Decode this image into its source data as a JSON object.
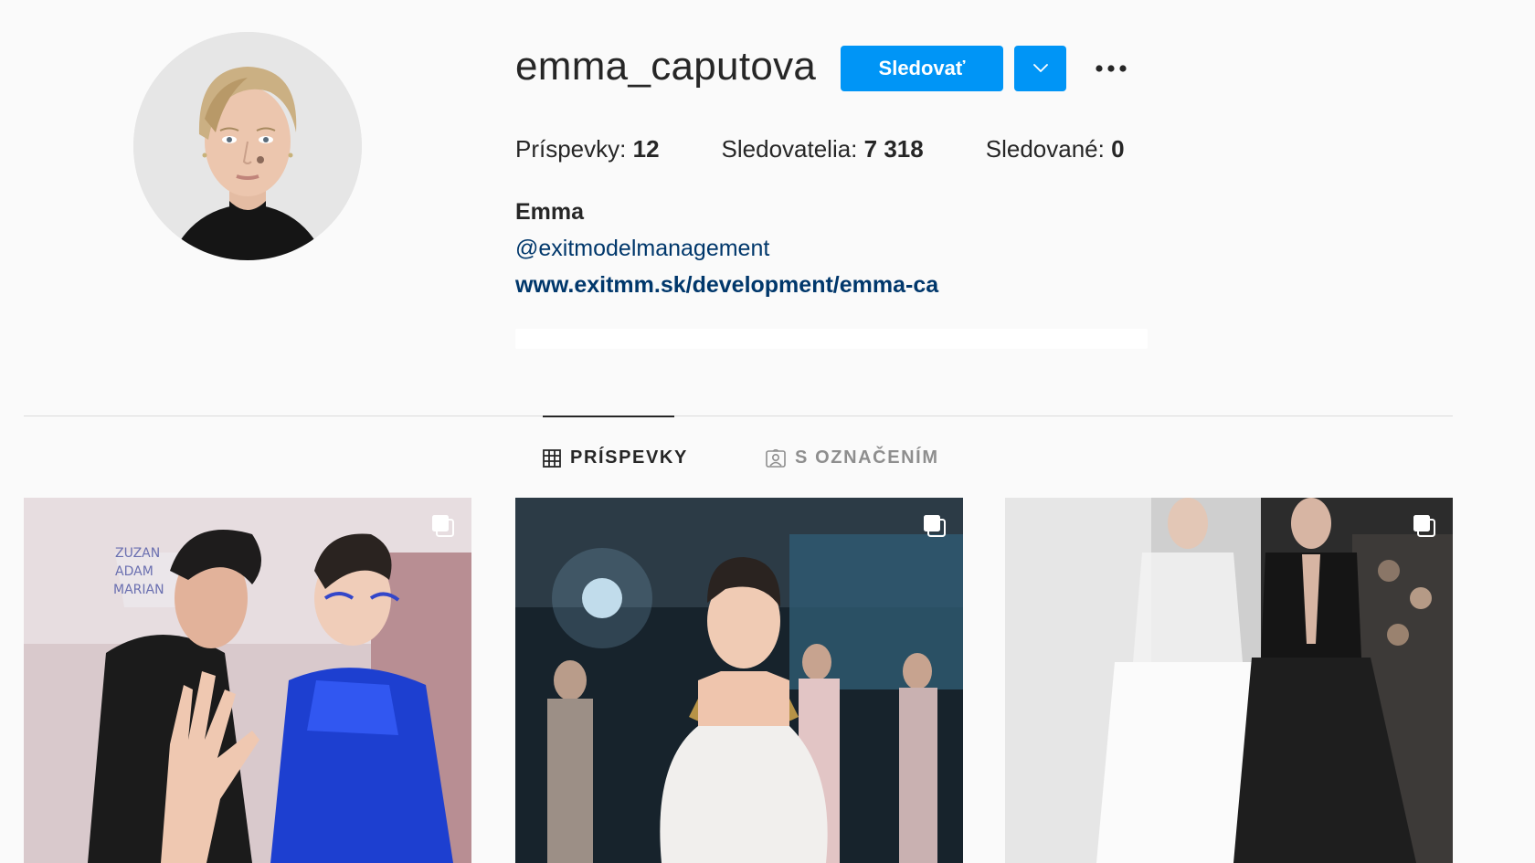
{
  "profile": {
    "username": "emma_caputova",
    "full_name": "Emma",
    "bio_mention": "@exitmodelmanagement",
    "bio_link": "www.exitmm.sk/development/emma-ca"
  },
  "actions": {
    "follow_label": "Sledovať",
    "dropdown_icon": "chevron-down-icon",
    "options_icon": "more-options-icon"
  },
  "stats": {
    "posts_label": "Príspevky:",
    "posts_value": "12",
    "followers_label": "Sledovatelia:",
    "followers_value": "7 318",
    "following_label": "Sledované:",
    "following_value": "0"
  },
  "tabs": [
    {
      "label": "PRÍSPEVKY",
      "icon": "grid-icon",
      "active": true
    },
    {
      "label": "S OZNAČENÍM",
      "icon": "tagged-user-icon",
      "active": false
    }
  ],
  "posts": [
    {
      "kind": "carousel",
      "icon": "multiple-posts-icon"
    },
    {
      "kind": "carousel",
      "icon": "multiple-posts-icon"
    },
    {
      "kind": "carousel",
      "icon": "multiple-posts-icon"
    }
  ],
  "colors": {
    "accent": "#0095f6",
    "link": "#00376b",
    "background": "#fafafa",
    "text": "#262626",
    "muted": "#8e8e8e"
  }
}
